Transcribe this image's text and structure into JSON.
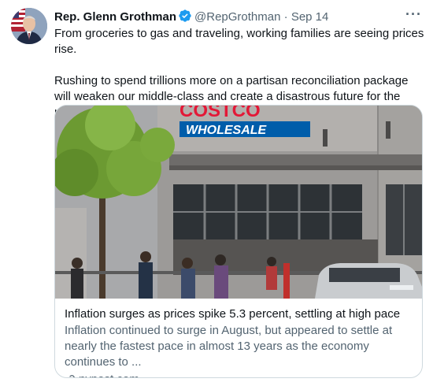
{
  "author": {
    "name": "Rep. Glenn Grothman",
    "handle": "@RepGrothman",
    "separator": "·",
    "date": "Sep 14",
    "more_label": "···"
  },
  "tweet": {
    "paragraphs": [
      "From groceries to gas and traveling, working families are seeing prices rise.",
      "Rushing to spend trillions more on a partisan reconciliation package will weaken our middle-class and create a disastrous future for the next generation of Americans."
    ]
  },
  "card": {
    "image_sign_top": "COSTCO",
    "image_sign_bottom": "WHOLESALE",
    "title": "Inflation surges as prices spike 5.3 percent, settling at high pace",
    "description": "Inflation continued to surge in August, but appeared to settle at nearly the fastest pace in almost 13 years as the economy continues to ...",
    "source": "nypost.com"
  },
  "colors": {
    "verified_blue": "#1d9bf0",
    "text_primary": "#0f1419",
    "text_secondary": "#536471",
    "border": "#cfd9de",
    "costco_red": "#e31837",
    "costco_blue": "#005daa"
  }
}
